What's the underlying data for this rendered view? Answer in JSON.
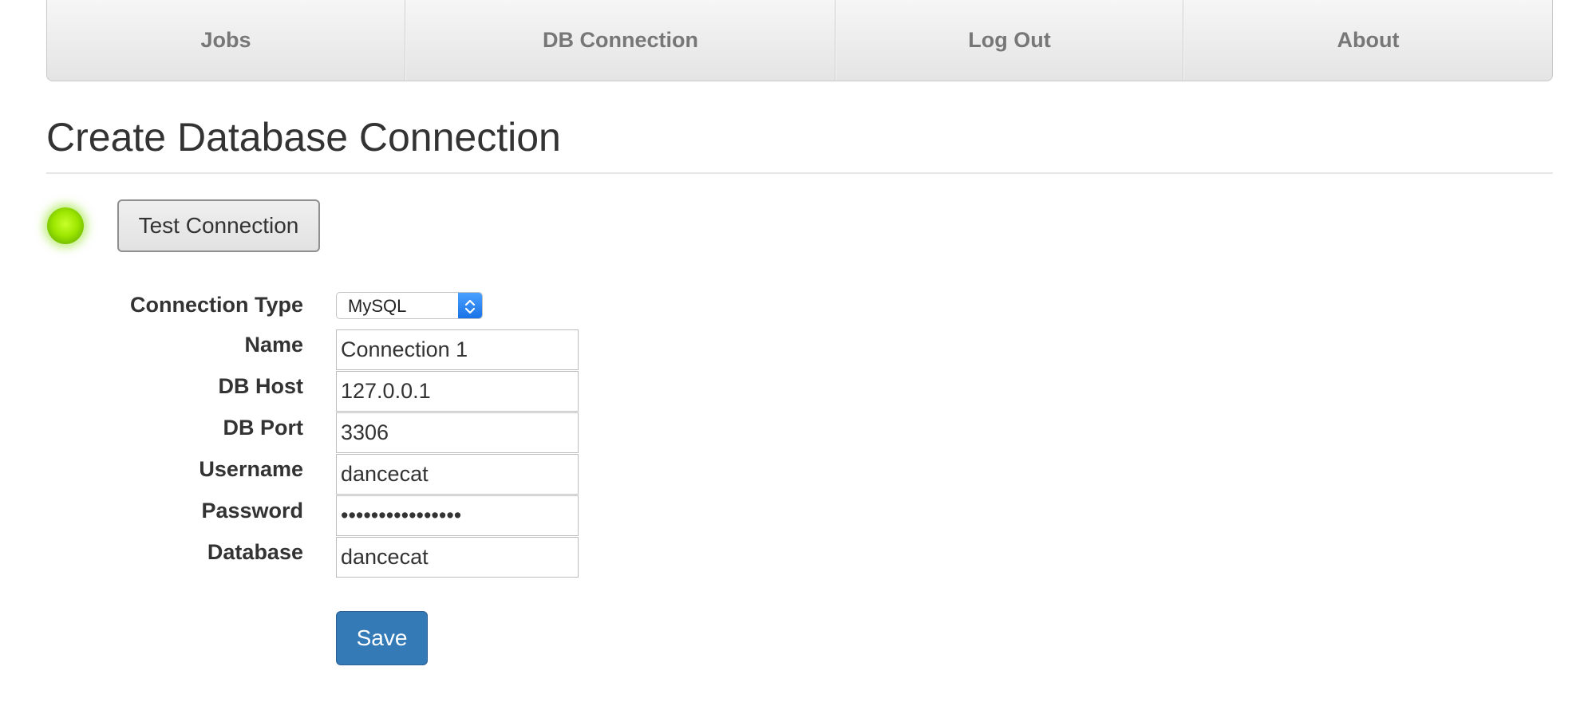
{
  "nav": {
    "items": [
      {
        "label": "Jobs"
      },
      {
        "label": "DB Connection"
      },
      {
        "label": "Log Out"
      },
      {
        "label": "About"
      }
    ]
  },
  "page": {
    "title": "Create Database Connection"
  },
  "status": {
    "indicator_color": "#9ce600",
    "indicator_state": "connected"
  },
  "actions": {
    "test_connection_label": "Test Connection",
    "save_label": "Save"
  },
  "form": {
    "connection_type": {
      "label": "Connection Type",
      "value": "MySQL"
    },
    "name": {
      "label": "Name",
      "value": "Connection 1"
    },
    "db_host": {
      "label": "DB Host",
      "value": "127.0.0.1"
    },
    "db_port": {
      "label": "DB Port",
      "value": "3306"
    },
    "username": {
      "label": "Username",
      "value": "dancecat"
    },
    "password": {
      "label": "Password",
      "value": "dancecat12345678"
    },
    "database": {
      "label": "Database",
      "value": "dancecat"
    }
  },
  "colors": {
    "primary": "#337ab7",
    "nav_text": "#777777",
    "text": "#333333"
  }
}
